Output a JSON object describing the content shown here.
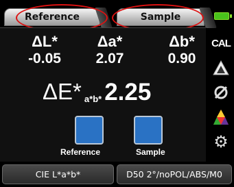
{
  "tabs": {
    "reference_label": "Reference",
    "sample_label": "Sample"
  },
  "delta": {
    "L_label": "ΔL*",
    "L_value": "-0.05",
    "a_label": "Δa*",
    "a_value": "2.07",
    "b_label": "Δb*",
    "b_value": "0.90",
    "E_symbol": "ΔE*",
    "E_subscript": "a*b*",
    "E_value": "2.25"
  },
  "swatches": {
    "reference_label": "Reference",
    "sample_label": "Sample",
    "reference_color": "#2a72c4",
    "sample_color": "#2a72c4"
  },
  "sidebar": {
    "cal_label": "CAL",
    "icons": [
      "battery-icon",
      "cal-icon",
      "delta-triangle-icon",
      "measure-circle-icon",
      "color-palette-icon",
      "settings-gear-icon"
    ]
  },
  "bottom": {
    "colorspace_label": "CIE L*a*b*",
    "conditions_label": "D50 2°/noPOL/ABS/M0"
  },
  "colors": {
    "highlight_ring": "#d11111",
    "battery": "#49c11c"
  }
}
